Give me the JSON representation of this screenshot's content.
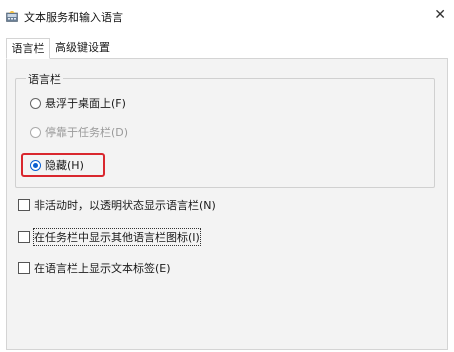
{
  "window": {
    "title": "文本服务和输入语言",
    "close_glyph": "✕"
  },
  "tabs": [
    {
      "label": "语言栏",
      "active": true
    },
    {
      "label": "高级键设置",
      "active": false
    }
  ],
  "language_bar_group": {
    "label": "语言栏",
    "options": [
      {
        "label": "悬浮于桌面上(F)",
        "checked": false,
        "disabled": false
      },
      {
        "label": "停靠于任务栏(D)",
        "checked": false,
        "disabled": true
      },
      {
        "label": "隐藏(H)",
        "checked": true,
        "disabled": false
      }
    ]
  },
  "checkboxes": [
    {
      "label": "非活动时，以透明状态显示语言栏(N)",
      "checked": false
    },
    {
      "label": "在任务栏中显示其他语言栏图标(I)",
      "checked": false,
      "focused": true
    },
    {
      "label": "在语言栏上显示文本标签(E)",
      "checked": false
    }
  ],
  "colors": {
    "accent": "#0a5fd1",
    "highlight_border": "#d9272e",
    "panel_bg": "#f3f3f3"
  }
}
